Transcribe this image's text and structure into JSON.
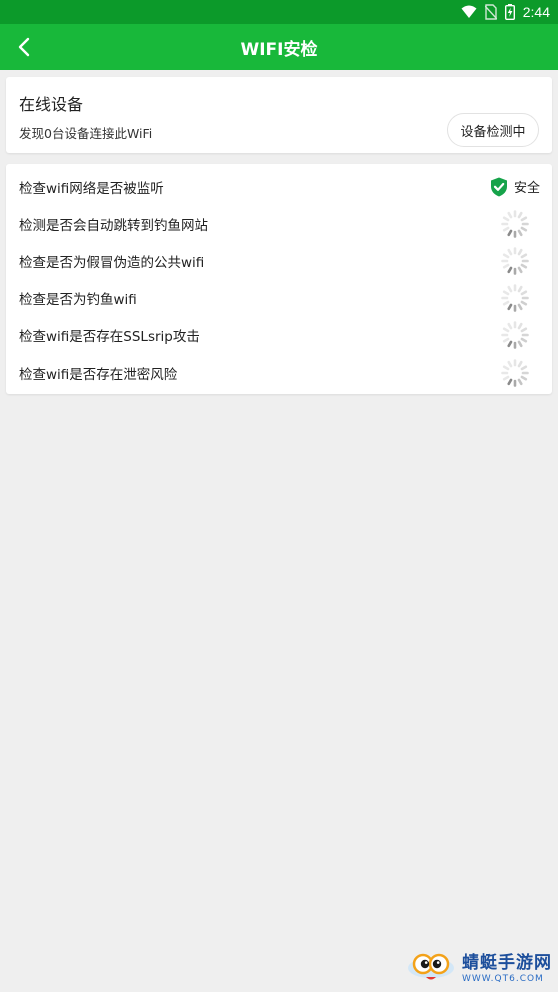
{
  "status_bar": {
    "time": "2:44",
    "icons": [
      "wifi-icon",
      "no-sim-icon",
      "battery-charging-icon"
    ]
  },
  "app_bar": {
    "title": "WIFI安检",
    "back_icon": "chevron-left-icon"
  },
  "online_devices": {
    "title": "在线设备",
    "description": "发现0台设备连接此WiFi",
    "button_label": "设备检测中"
  },
  "checks": [
    {
      "label": "检查wifi网络是否被监听",
      "status": "safe",
      "status_text": "安全"
    },
    {
      "label": "检测是否会自动跳转到钓鱼网站",
      "status": "loading"
    },
    {
      "label": "检查是否为假冒伪造的公共wifi",
      "status": "loading"
    },
    {
      "label": "检查是否为钓鱼wifi",
      "status": "loading"
    },
    {
      "label": "检查wifi是否存在SSLsrip攻击",
      "status": "loading"
    },
    {
      "label": "检查wifi是否存在泄密风险",
      "status": "loading"
    }
  ],
  "watermark": {
    "title": "蜻蜓手游网",
    "subtitle": "WWW.QT6.COM"
  },
  "colors": {
    "status_bar": "#0c9a2a",
    "app_bar": "#18b83a",
    "safe_shield": "#16a34a",
    "background": "#efefef"
  }
}
